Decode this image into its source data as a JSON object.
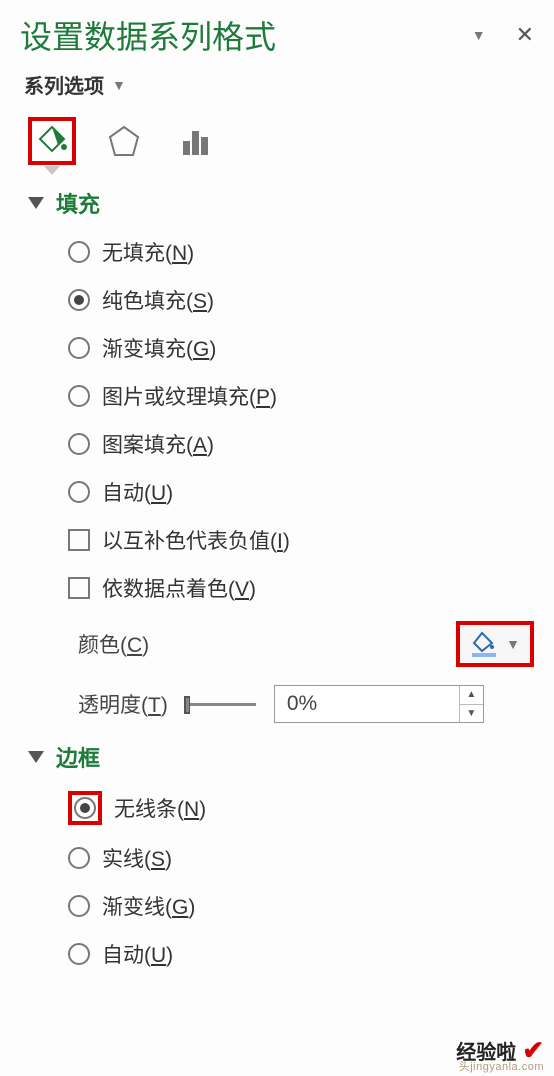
{
  "header": {
    "title": "设置数据系列格式",
    "series_label": "系列选项"
  },
  "tabs": {
    "fill_line": "fill-line-icon",
    "effects": "pentagon-icon",
    "series": "bar-chart-icon"
  },
  "fill_section": {
    "title": "填充",
    "options": {
      "no_fill": "无填充",
      "no_fill_key": "N",
      "solid": "纯色填充",
      "solid_key": "S",
      "gradient": "渐变填充",
      "gradient_key": "G",
      "picture": "图片或纹理填充",
      "picture_key": "P",
      "pattern": "图案填充",
      "pattern_key": "A",
      "auto": "自动",
      "auto_key": "U",
      "invert_neg": "以互补色代表负值",
      "invert_neg_key": "I",
      "vary_point": "依数据点着色",
      "vary_point_key": "V"
    },
    "color_label": "颜色",
    "color_key": "C",
    "transparency_label": "透明度",
    "transparency_key": "T",
    "transparency_value": "0%"
  },
  "border_section": {
    "title": "边框",
    "options": {
      "no_line": "无线条",
      "no_line_key": "N",
      "solid": "实线",
      "solid_key": "S",
      "gradient": "渐变线",
      "gradient_key": "G",
      "auto": "自动",
      "auto_key": "U"
    }
  },
  "watermark": {
    "text": "经验啦",
    "url": "头jingyanla.com"
  }
}
